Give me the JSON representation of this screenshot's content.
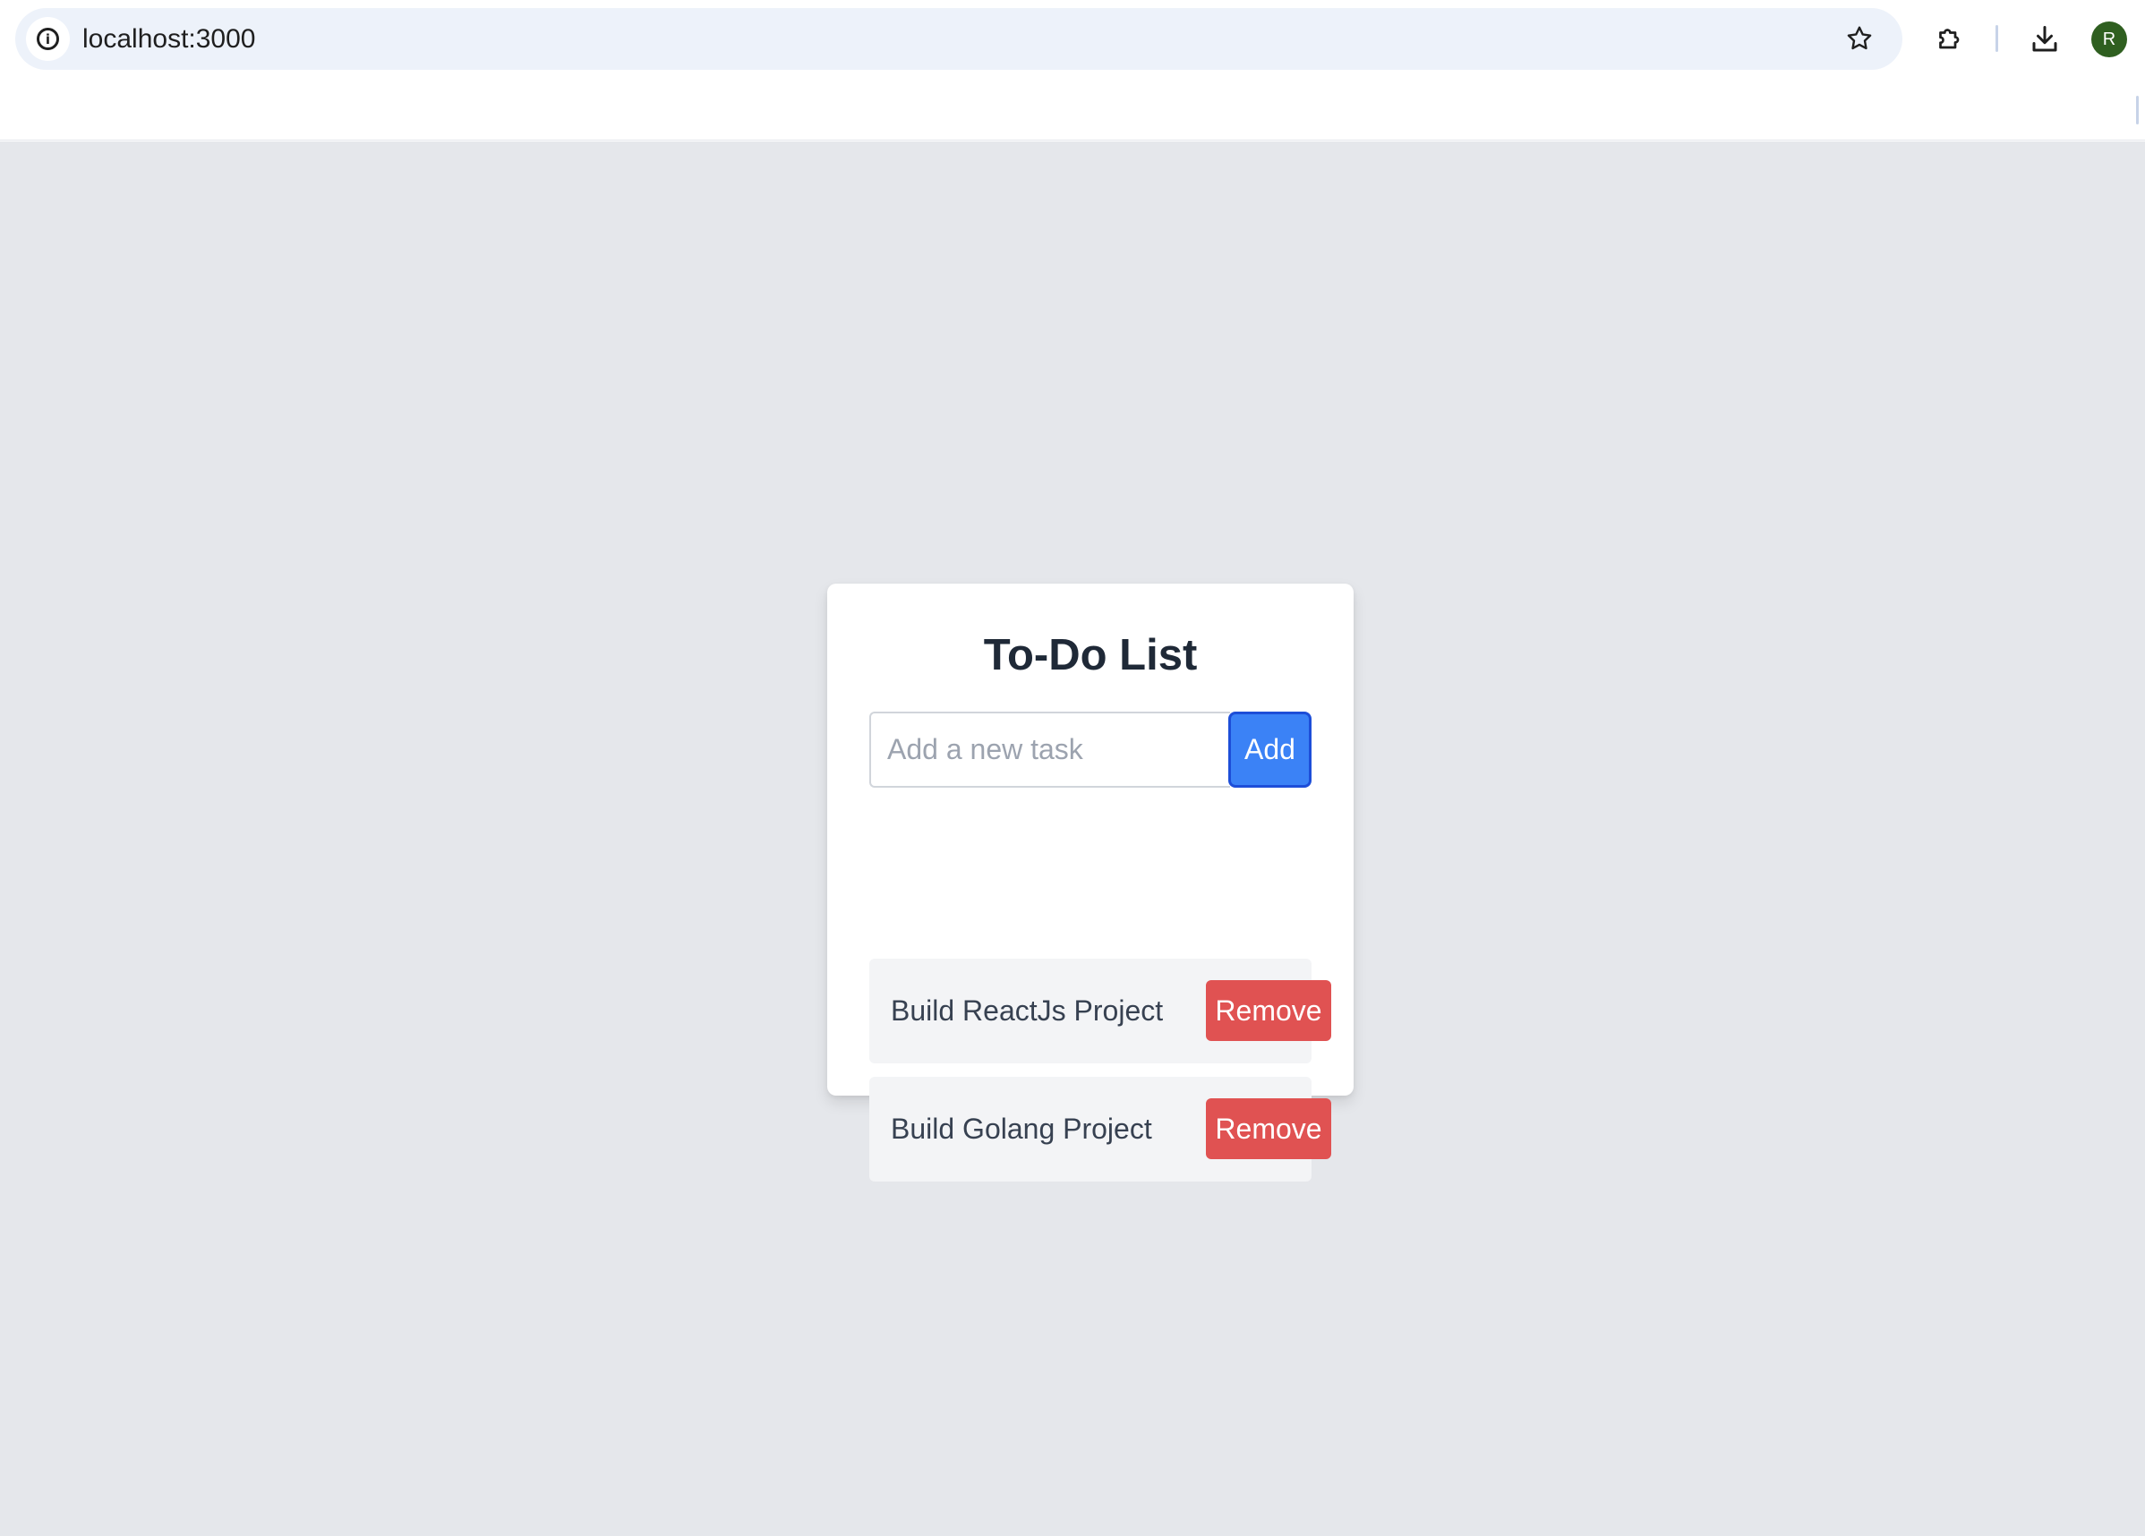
{
  "browser": {
    "url": "localhost:3000",
    "site_info_icon": "info-icon",
    "bookmark_icon": "star-icon",
    "extensions_icon": "puzzle-icon",
    "downloads_icon": "download-icon",
    "profile_initial": "R",
    "profile_color": "#2f5f20"
  },
  "app": {
    "title": "To-Do List",
    "input": {
      "value": "",
      "placeholder": "Add a new task"
    },
    "add_label": "Add",
    "remove_label": "Remove",
    "tasks": [
      {
        "text": "Build ReactJs Project"
      },
      {
        "text": "Build Golang Project"
      }
    ]
  },
  "colors": {
    "primary": "#3b82f6",
    "danger": "#e05252",
    "page_background": "#e5e7eb"
  }
}
